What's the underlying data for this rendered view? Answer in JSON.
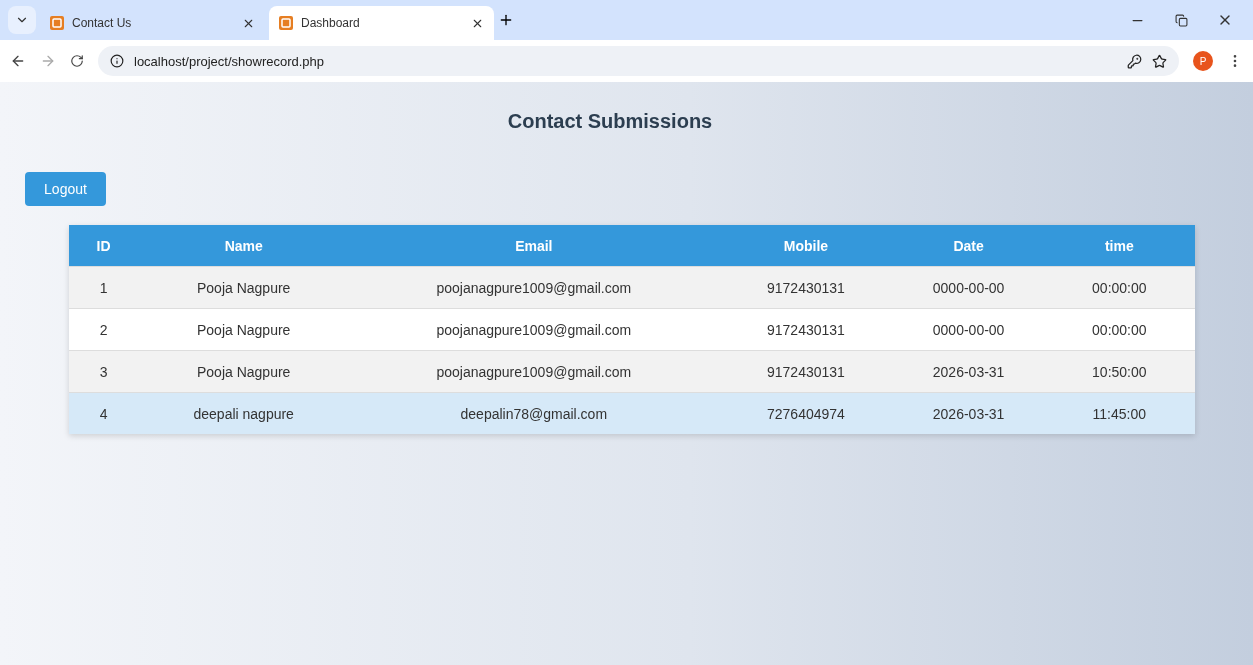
{
  "browser": {
    "tabs": [
      {
        "title": "Contact Us",
        "selected": false
      },
      {
        "title": "Dashboard",
        "selected": true
      }
    ],
    "url": "localhost/project/showrecord.php",
    "profile_initial": "P"
  },
  "page": {
    "title": "Contact Submissions",
    "logout_button": "Logout",
    "table": {
      "columns": [
        "ID",
        "Name",
        "Email",
        "Mobile",
        "Date",
        "time"
      ],
      "rows": [
        {
          "cells": [
            "1",
            "Pooja Nagpure",
            "poojanagpure1009@gmail.com",
            "9172430131",
            "0000-00-00",
            "00:00:00"
          ],
          "selected": false
        },
        {
          "cells": [
            "2",
            "Pooja Nagpure",
            "poojanagpure1009@gmail.com",
            "9172430131",
            "0000-00-00",
            "00:00:00"
          ],
          "selected": false
        },
        {
          "cells": [
            "3",
            "Pooja Nagpure",
            "poojanagpure1009@gmail.com",
            "9172430131",
            "2026-03-31",
            "10:50:00"
          ],
          "selected": false
        },
        {
          "cells": [
            "4",
            "deepali nagpure",
            "deepalin78@gmail.com",
            "7276404974",
            "2026-03-31",
            "11:45:00"
          ],
          "selected": true
        }
      ]
    }
  }
}
